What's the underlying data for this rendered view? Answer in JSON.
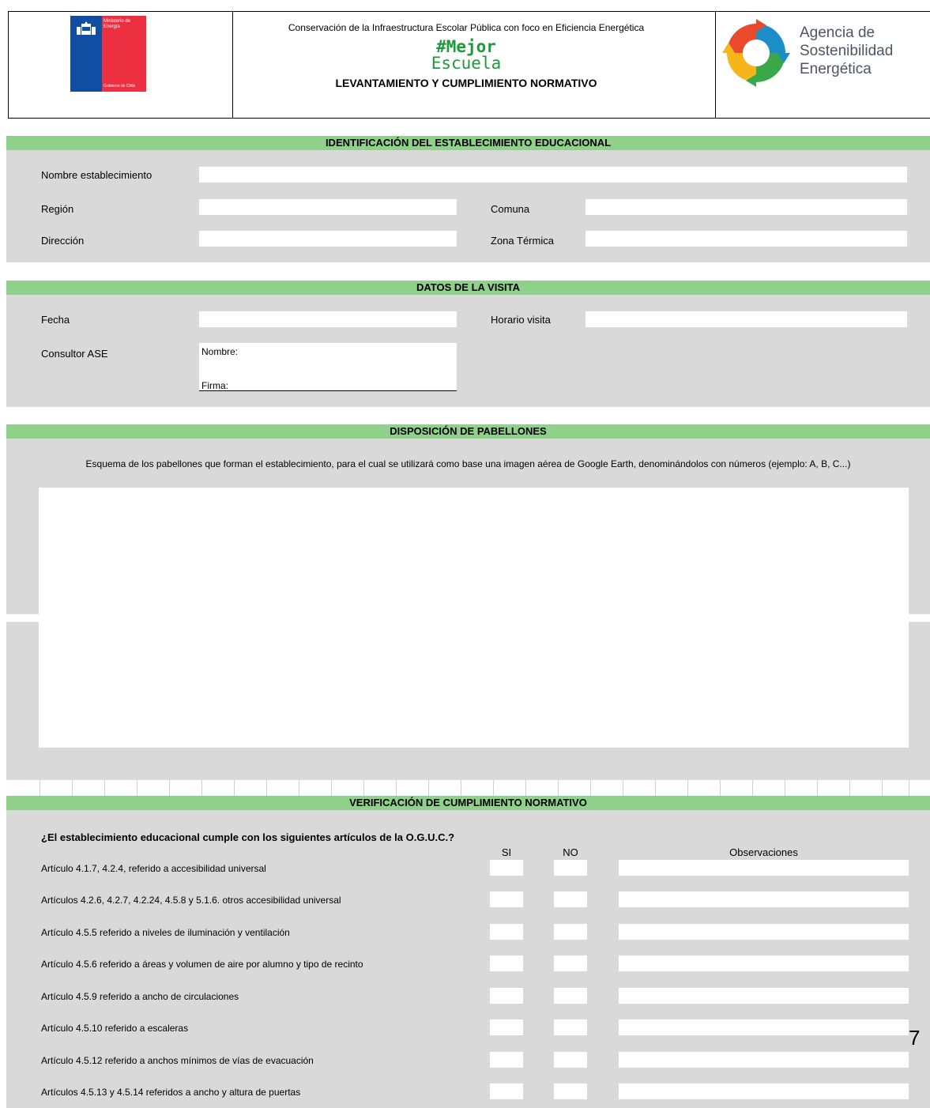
{
  "header": {
    "gov_logo_text": "Ministerio de Energía",
    "gov_logo_footer": "Gobierno de Chile",
    "subtitle": "Conservación de la Infraestructura Escolar Pública con foco en Eficiencia Energética",
    "brand_line1": "#Mejor",
    "brand_line2": "Escuela",
    "title": "LEVANTAMIENTO Y CUMPLIMIENTO NORMATIVO",
    "agency_line1": "Agencia de",
    "agency_line2": "Sostenibilidad",
    "agency_line3": "Energética"
  },
  "identificacion": {
    "title": "IDENTIFICACIÓN DEL ESTABLECIMIENTO EDUCACIONAL",
    "nombre_label": "Nombre establecimiento",
    "region_label": "Región",
    "comuna_label": "Comuna",
    "direccion_label": "Dirección",
    "zona_label": "Zona Térmica"
  },
  "visita": {
    "title": "DATOS DE LA VISITA",
    "fecha_label": "Fecha",
    "horario_label": "Horario visita",
    "consultor_label": "Consultor ASE",
    "nombre_label": "Nombre:",
    "firma_label": "Firma:"
  },
  "pabellones": {
    "title": "DISPOSICIÓN DE PABELLONES",
    "description": "Esquema de los pabellones que forman el establecimiento, para el cual se utilizará como base una imagen aérea de Google Earth, denominándolos con números (ejemplo: A, B, C...)"
  },
  "verificacion": {
    "title": "VERIFICACIÓN DE CUMPLIMIENTO NORMATIVO",
    "question": "¿El establecimiento educacional cumple con los siguientes artículos de la O.G.U.C.?",
    "col_si": "SI",
    "col_no": "NO",
    "col_obs": "Observaciones",
    "rows": [
      "Artículo 4.1.7, 4.2.4,  referido a accesibilidad universal",
      "Artículos 4.2.6, 4.2.7, 4.2.24, 4.5.8 y 5.1.6. otros accesibilidad universal",
      "Artículo 4.5.5 referido a niveles de iluminación y ventilación",
      "Artículo 4.5.6 referido a áreas y volumen de aire por alumno y tipo de recinto",
      "Artículo 4.5.9 referido a ancho de circulaciones",
      "Artículo 4.5.10 referido a escaleras",
      "Artículo 4.5.12 referido a anchos mínimos de vías de evacuación",
      "Artículos 4.5.13 y 4.5.14 referidos a ancho y altura de puertas"
    ]
  },
  "page_number": "7",
  "colors": {
    "band": "#8fd18a",
    "panel": "#d9d9d9",
    "brand_green": "#1e9a3a"
  }
}
